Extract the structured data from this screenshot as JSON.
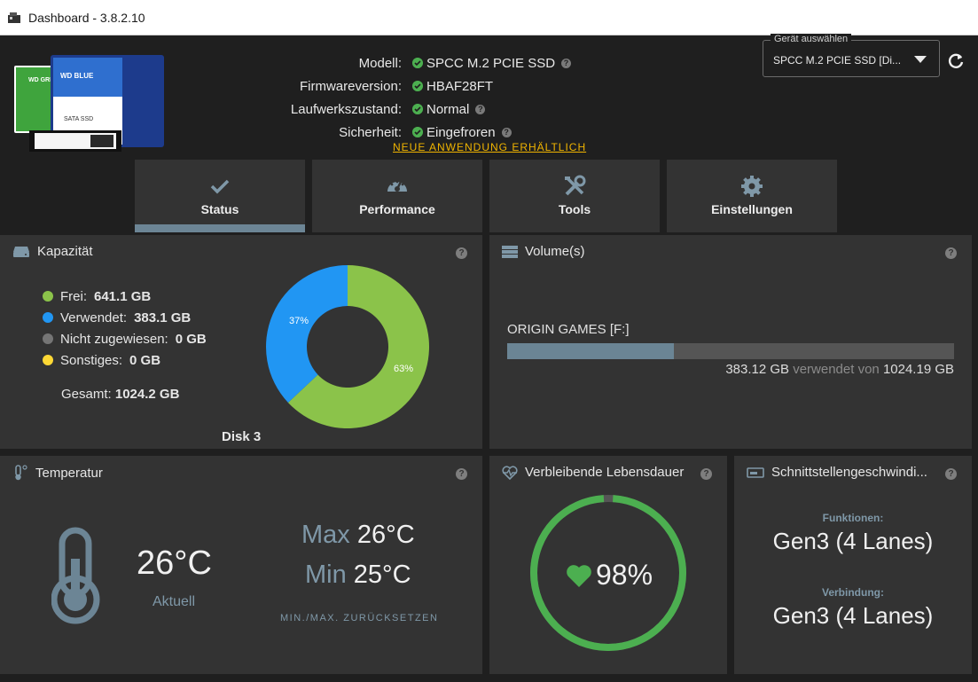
{
  "window": {
    "title": "Dashboard - 3.8.2.10"
  },
  "info": {
    "model_label": "Modell:",
    "model_value": "SPCC M.2 PCIE SSD",
    "firmware_label": "Firmwareversion:",
    "firmware_value": "HBAF28FT",
    "health_label": "Laufwerkszustand:",
    "health_value": "Normal",
    "security_label": "Sicherheit:",
    "security_value": "Eingefroren"
  },
  "product_image": {
    "card_left_text": "WD GREEN",
    "card_right_text": "WD BLUE",
    "card_right_sub": "SATA SSD"
  },
  "new_app_link": "NEUE ANWENDUNG ERHÄLTLICH",
  "device_select": {
    "legend": "Gerät auswählen",
    "value": "SPCC M.2 PCIE SSD [Di..."
  },
  "tabs": [
    {
      "label": "Status",
      "icon": "check-icon",
      "active": true
    },
    {
      "label": "Performance",
      "icon": "speedometer-icon",
      "active": false
    },
    {
      "label": "Tools",
      "icon": "tools-icon",
      "active": false
    },
    {
      "label": "Einstellungen",
      "icon": "gear-icon",
      "active": false
    }
  ],
  "capacity": {
    "title": "Kapazität",
    "legend": [
      {
        "label": "Frei:",
        "value": "641.1 GB",
        "color": "#8bc34a"
      },
      {
        "label": "Verwendet:",
        "value": "383.1 GB",
        "color": "#2196f3"
      },
      {
        "label": "Nicht zugewiesen:",
        "value": "0 GB",
        "color": "#757575"
      },
      {
        "label": "Sonstiges:",
        "value": "0 GB",
        "color": "#fdd835"
      }
    ],
    "total_label": "Gesamt:",
    "total_value": "1024.2 GB",
    "disk_label": "Disk 3",
    "donut": {
      "free_pct": 63,
      "used_pct": 37,
      "free_label": "63%",
      "used_label": "37%"
    }
  },
  "volumes": {
    "title": "Volume(s)",
    "items": [
      {
        "name": "ORIGIN GAMES [F:]",
        "used_fraction": 0.374,
        "used": "383.12 GB",
        "mid": "verwendet von",
        "total": "1024.19 GB"
      }
    ]
  },
  "temperature": {
    "title": "Temperatur",
    "current": "26°C",
    "current_label": "Aktuell",
    "max_label": "Max",
    "max_value": "26°C",
    "min_label": "Min",
    "min_value": "25°C",
    "reset_label": "MIN./MAX. ZURÜCKSETZEN"
  },
  "lifetime": {
    "title": "Verbleibende Lebensdauer",
    "value": "98%",
    "fraction": 0.98,
    "color": "#4caf50"
  },
  "interface": {
    "title": "Schnittstellengeschwindi...",
    "functions_label": "Funktionen:",
    "functions_value": "Gen3 (4 Lanes)",
    "connection_label": "Verbindung:",
    "connection_value": "Gen3 (4 Lanes)"
  }
}
